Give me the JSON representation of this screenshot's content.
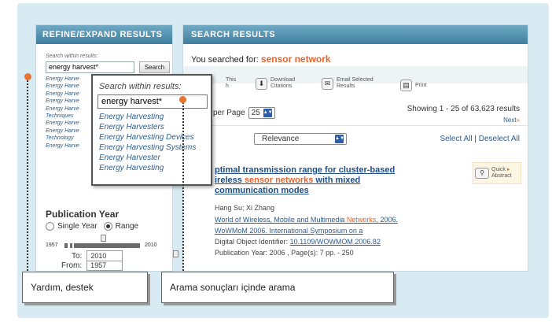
{
  "left_panel": {
    "title": "REFINE/EXPAND RESULTS",
    "search_within_label": "Search within results:",
    "search_within_value": "energy harvest*",
    "search_button": "Search",
    "suggestion_snippets": [
      "Energy Harve",
      "Energy Harve",
      "Energy Harve",
      "Energy Harve",
      "Energy Harve",
      "Techniques",
      "Energy Harve",
      "Energy Harve",
      "Technology",
      "Energy Harve"
    ],
    "publication_year": {
      "title": "Publication Year",
      "single_year_label": "Single Year",
      "range_label": "Range",
      "selected": "Range",
      "slider_min": "1957",
      "slider_max": "2010",
      "from_label": "From:",
      "from_value": "1957",
      "to_label": "To:",
      "to_value": "2010"
    }
  },
  "right_panel": {
    "title": "SEARCH RESULTS",
    "searched_prefix": "You searched for:",
    "searched_term": "sensor network",
    "tools": [
      {
        "label_line1": "This",
        "label_line2": "h",
        "icon": "checkbox-icon"
      },
      {
        "label_line1": "Download",
        "label_line2": "Citations",
        "icon": "download-icon"
      },
      {
        "label_line1": "Email Selected",
        "label_line2": "Results",
        "icon": "email-icon"
      },
      {
        "label_line1": "Print",
        "label_line2": "",
        "icon": "print-icon"
      }
    ],
    "per_page_label": "per Page",
    "per_page_value": "25",
    "showing": "Showing 1 - 25 of 63,623 results",
    "next_label": "Next",
    "next_glyph": "»",
    "sort_value": "Relevance",
    "select_all": "Select All",
    "select_separator": "|",
    "deselect_all": "Deselect All",
    "quick_abstract_line1": "Quick",
    "quick_abstract_line2": "Abstract",
    "result": {
      "title_part1": "ptimal transmission range for cluster-based",
      "title_part2": "ireless",
      "title_highlight": "sensor networks",
      "title_part3": "with mixed",
      "title_part4": "communication modes",
      "authors": "Hang Su; Xi Zhang",
      "venue_part1": "World of Wireless, Mobile and Multimedia",
      "venue_highlight": "Networks",
      "venue_part2": ", 2006.",
      "venue_line2": "WoWMoM 2006. International Symposium on a",
      "doi_label": "Digital Object Identifier:",
      "doi_value": "10.1109/WOWMOM.2006.82",
      "pub_info": "Publication Year: 2006 , Page(s): 7 pp. - 250"
    }
  },
  "popup": {
    "label": "Search within results:",
    "input_value": "energy harvest*",
    "suggestions": [
      "Energy Harvesting",
      "Energy Harvesters",
      "Energy Harvesting Devices",
      "Energy Harvesting Systems",
      "Energy Harvester",
      "Energy Harvesting"
    ]
  },
  "callouts": {
    "help": "Yardım, destek",
    "search_within": "Arama sonuçları içinde arama"
  },
  "colors": {
    "header_blue": "#4e8fb0",
    "highlight_orange": "#e8632b",
    "marker_orange": "#e8742f",
    "link_blue": "#2a5d8f"
  }
}
